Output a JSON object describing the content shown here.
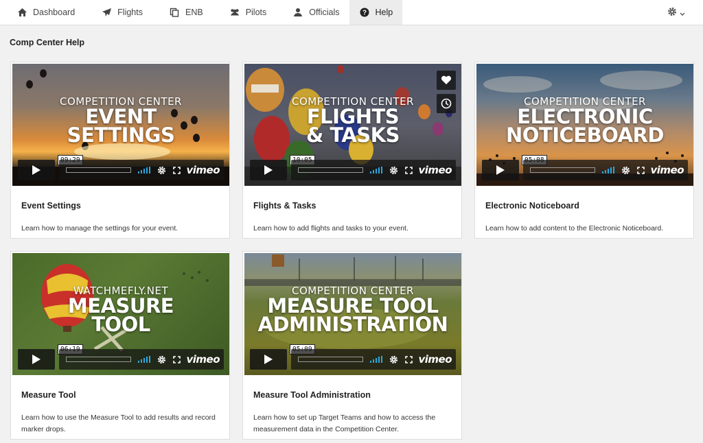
{
  "nav": {
    "items": [
      {
        "label": "Dashboard",
        "icon": "home-icon"
      },
      {
        "label": "Flights",
        "icon": "paper-plane-icon"
      },
      {
        "label": "ENB",
        "icon": "copy-icon"
      },
      {
        "label": "Pilots",
        "icon": "users-icon"
      },
      {
        "label": "Officials",
        "icon": "official-icon"
      },
      {
        "label": "Help",
        "icon": "question-circle-icon",
        "active": true
      }
    ],
    "settings_icon": "gear-icon"
  },
  "page": {
    "title": "Comp Center Help"
  },
  "cards": [
    {
      "video": {
        "line1": "COMPETITION CENTER",
        "line2": "EVENT",
        "line3": "SETTINGS",
        "time": "09:29",
        "brand": "vimeo"
      },
      "title": "Event Settings",
      "desc": "Learn how to manage the settings for your event."
    },
    {
      "video": {
        "line1": "COMPETITION CENTER",
        "line2": "FLIGHTS",
        "line3": "& TASKS",
        "time": "10:05",
        "brand": "vimeo"
      },
      "title": "Flights & Tasks",
      "desc": "Learn how to add flights and tasks to your event."
    },
    {
      "video": {
        "line1": "COMPETITION CENTER",
        "line2": "ELECTRONIC",
        "line3": "NOTICEBOARD",
        "time": "05:08",
        "brand": "vimeo"
      },
      "title": "Electronic Noticeboard",
      "desc": "Learn how to add content to the Electronic Noticeboard."
    },
    {
      "video": {
        "line1": "WATCHMEFLY.NET",
        "line2": "MEASURE",
        "line3": "TOOL",
        "time": "06:19",
        "brand": "vimeo"
      },
      "title": "Measure Tool",
      "desc": "Learn how to use the Measure Tool to add results and record marker drops."
    },
    {
      "video": {
        "line1": "COMPETITION CENTER",
        "line2": "MEASURE TOOL",
        "line3": "ADMINISTRATION",
        "time": "05:09",
        "brand": "vimeo"
      },
      "title": "Measure Tool Administration",
      "desc": "Learn how to set up Target Teams and how to access the measurement data in the Competition Center."
    }
  ],
  "colors": {
    "accent": "#29a9e0",
    "nav_active_bg": "#ececec"
  }
}
